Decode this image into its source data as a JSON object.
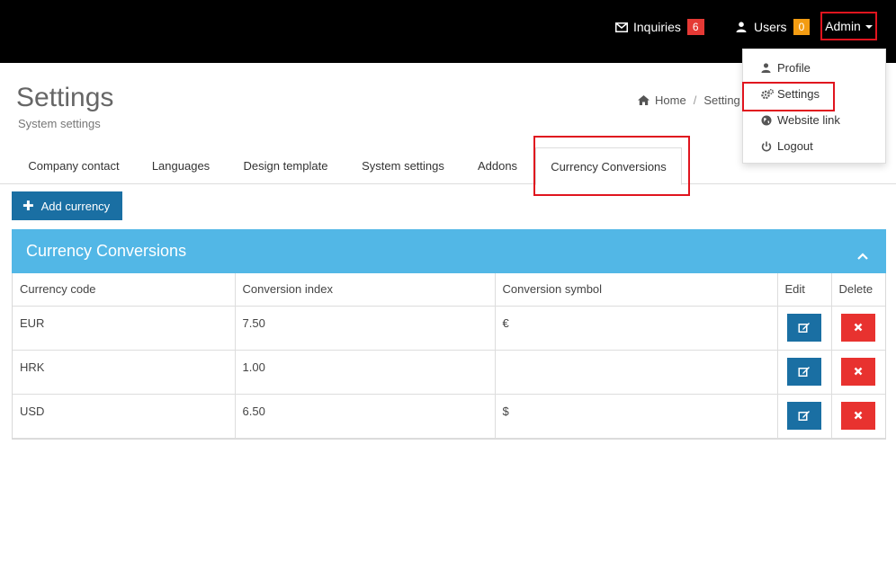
{
  "topbar": {
    "inquiries_label": "Inquiries",
    "inquiries_count": "6",
    "users_label": "Users",
    "users_count": "0",
    "admin_label": "Admin"
  },
  "header": {
    "title": "Settings",
    "subtitle": "System settings",
    "breadcrumb": [
      "Home",
      "Setting"
    ]
  },
  "tabs": [
    {
      "label": "Company contact"
    },
    {
      "label": "Languages"
    },
    {
      "label": "Design template"
    },
    {
      "label": "System settings"
    },
    {
      "label": "Addons"
    },
    {
      "label": "Currency Conversions",
      "active": true
    }
  ],
  "add_button_label": "Add currency",
  "panel": {
    "title": "Currency Conversions",
    "columns": [
      "Currency code",
      "Conversion index",
      "Conversion symbol",
      "Edit",
      "Delete"
    ],
    "rows": [
      {
        "code": "EUR",
        "index": "7.50",
        "symbol": "€"
      },
      {
        "code": "HRK",
        "index": "1.00",
        "symbol": ""
      },
      {
        "code": "USD",
        "index": "6.50",
        "symbol": "$"
      }
    ]
  },
  "dropdown": {
    "items": [
      {
        "label": "Profile",
        "icon": "user-icon"
      },
      {
        "label": "Settings",
        "icon": "cogs-icon"
      },
      {
        "label": "Website link",
        "icon": "globe-icon"
      },
      {
        "label": "Logout",
        "icon": "power-icon"
      }
    ]
  },
  "colors": {
    "topbar": "#000000",
    "panel_header": "#52b7e6",
    "primary_button": "#1a6fa3",
    "delete_button": "#e8322f",
    "highlight": "#e0141e"
  }
}
